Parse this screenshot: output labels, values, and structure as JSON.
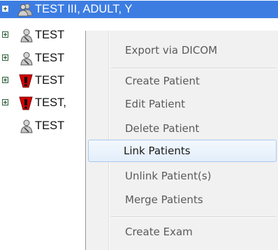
{
  "tree": {
    "rows": [
      {
        "label": "TEST III, ADULT, Y",
        "icon": "group-person-icon"
      },
      {
        "label": "TEST",
        "icon": "person-icon"
      },
      {
        "label": "TEST",
        "icon": "person-icon"
      },
      {
        "label": "TEST",
        "icon": "alert-person-icon"
      },
      {
        "label": "TEST,",
        "icon": "alert-person-icon"
      },
      {
        "label": "TEST",
        "icon": "person-icon"
      }
    ],
    "selection_color": "#3d7de2"
  },
  "context_menu": {
    "items": [
      {
        "label": "Export via DICOM"
      },
      {
        "label": "Create Patient"
      },
      {
        "label": "Edit Patient"
      },
      {
        "label": "Delete Patient"
      },
      {
        "label": "Link Patients"
      },
      {
        "label": "Unlink Patient(s)"
      },
      {
        "label": "Merge Patients"
      },
      {
        "label": "Create Exam"
      }
    ],
    "highlighted_item": "Link Patients"
  }
}
